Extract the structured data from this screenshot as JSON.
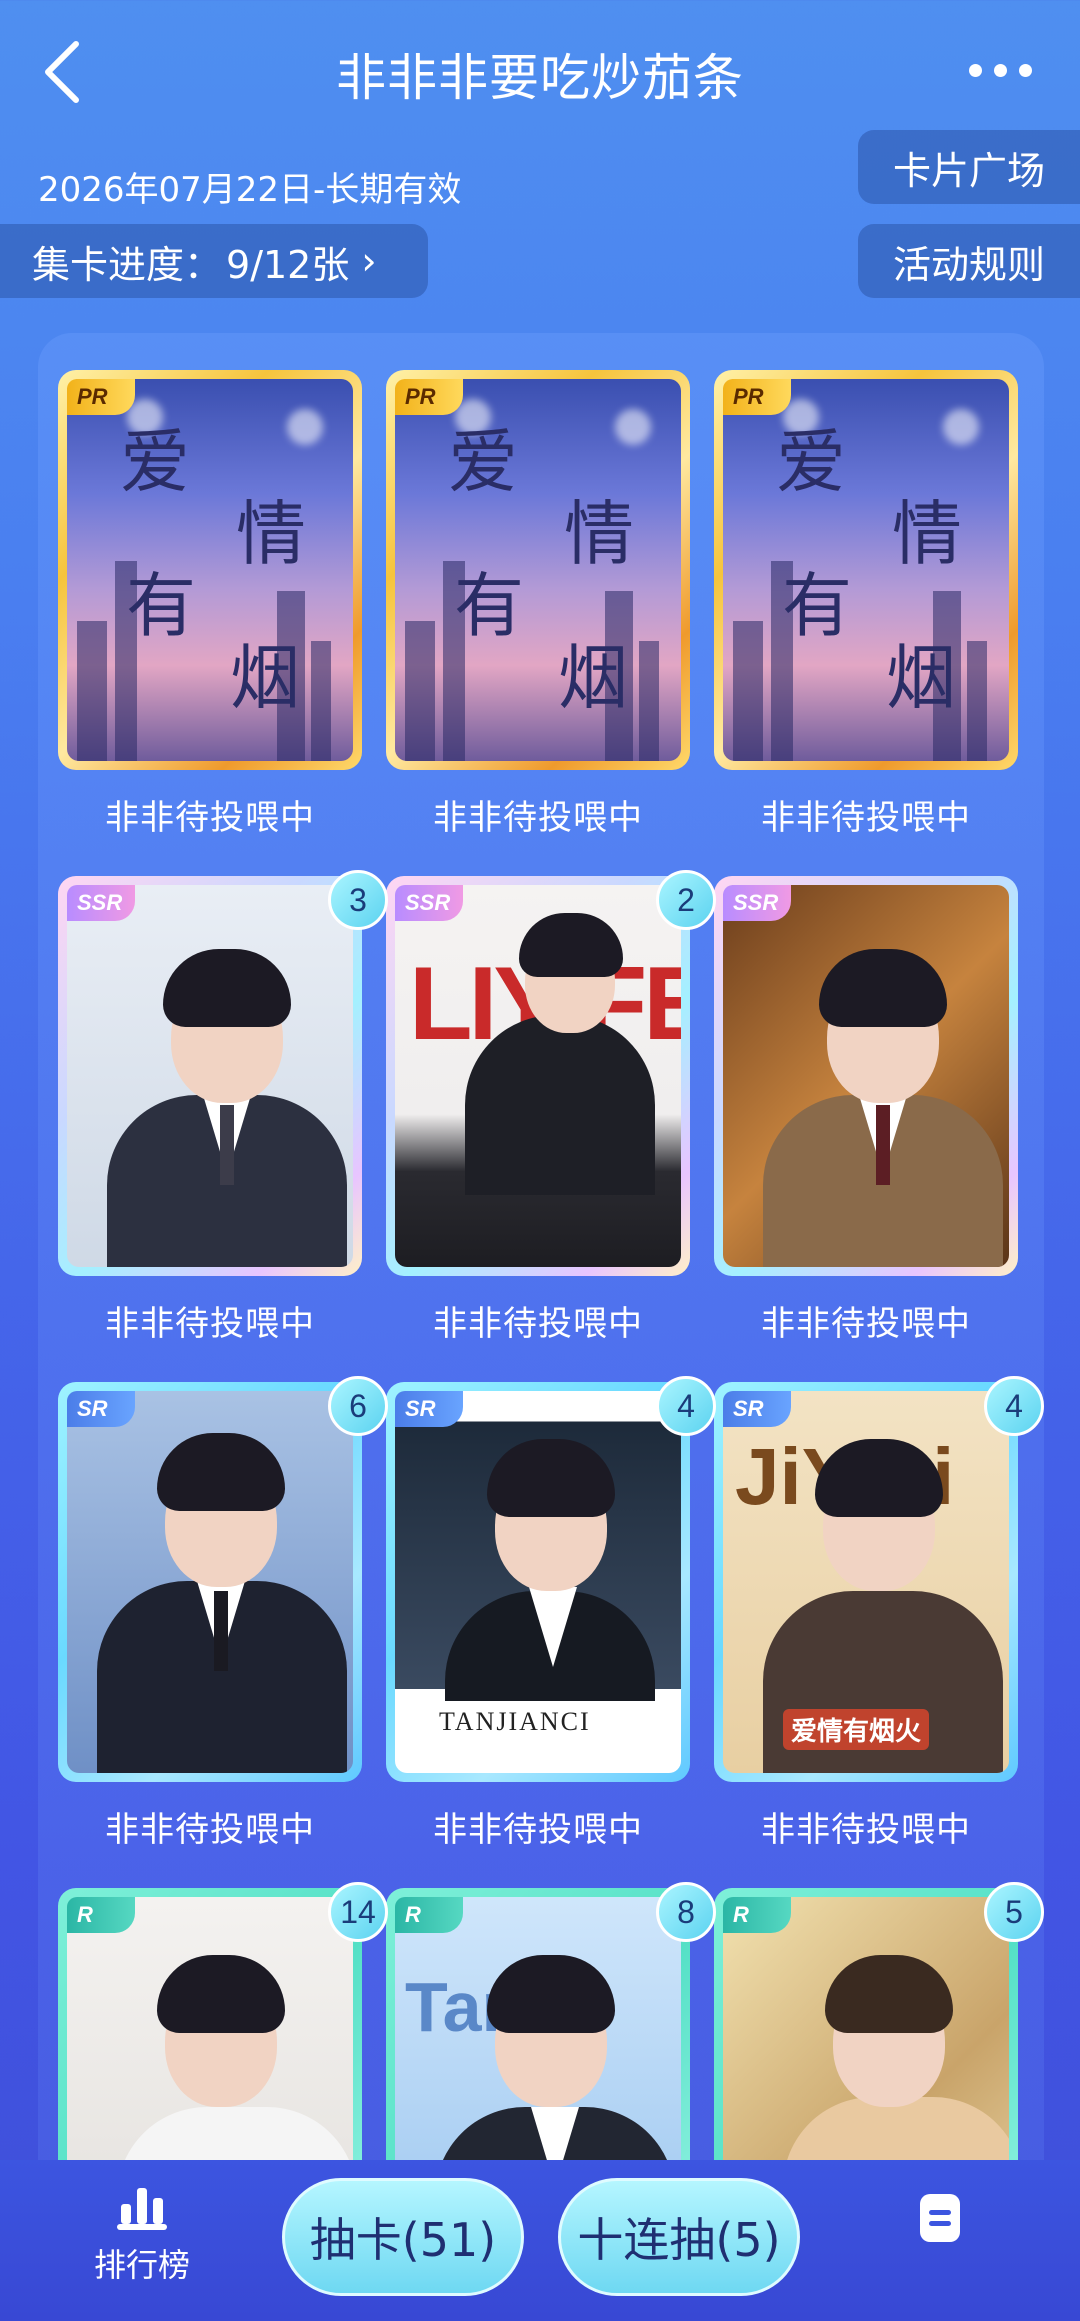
{
  "header": {
    "title": "非非非要吃炒茄条",
    "validity": "2026年07月22日-长期有效",
    "progress_label": "集卡进度：",
    "progress_value": "9/12张",
    "square_label": "卡片广场",
    "rules_label": "活动规则"
  },
  "cards": [
    {
      "rarity": "PR",
      "count": null,
      "caption": "非非待投喂中",
      "art_title": "爱情有烟火"
    },
    {
      "rarity": "PR",
      "count": null,
      "caption": "非非待投喂中",
      "art_title": "爱情有烟火"
    },
    {
      "rarity": "PR",
      "count": null,
      "caption": "非非待投喂中",
      "art_title": "爱情有烟火"
    },
    {
      "rarity": "SSR",
      "count": "3",
      "caption": "非非待投喂中"
    },
    {
      "rarity": "SSR",
      "count": "2",
      "caption": "非非待投喂中"
    },
    {
      "rarity": "SSR",
      "count": null,
      "caption": "非非待投喂中"
    },
    {
      "rarity": "SR",
      "count": "6",
      "caption": "非非待投喂中"
    },
    {
      "rarity": "SR",
      "count": "4",
      "caption": "非非待投喂中"
    },
    {
      "rarity": "SR",
      "count": "4",
      "caption": "非非待投喂中"
    },
    {
      "rarity": "R",
      "count": "14",
      "caption": ""
    },
    {
      "rarity": "R",
      "count": "8",
      "caption": ""
    },
    {
      "rarity": "R",
      "count": "5",
      "caption": ""
    }
  ],
  "bottom": {
    "rank_label": "排行榜",
    "draw_one": "抽卡(51)",
    "draw_ten": "十连抽(5)"
  },
  "icons": {
    "back": "chevron-left-icon",
    "more": "more-dots-icon",
    "rank": "bar-chart-icon",
    "notes": "note-icon"
  },
  "colors": {
    "bg_top": "#4f8ff0",
    "bg_bottom": "#3f4fd8",
    "button_cyan": "#6ed8f2"
  }
}
